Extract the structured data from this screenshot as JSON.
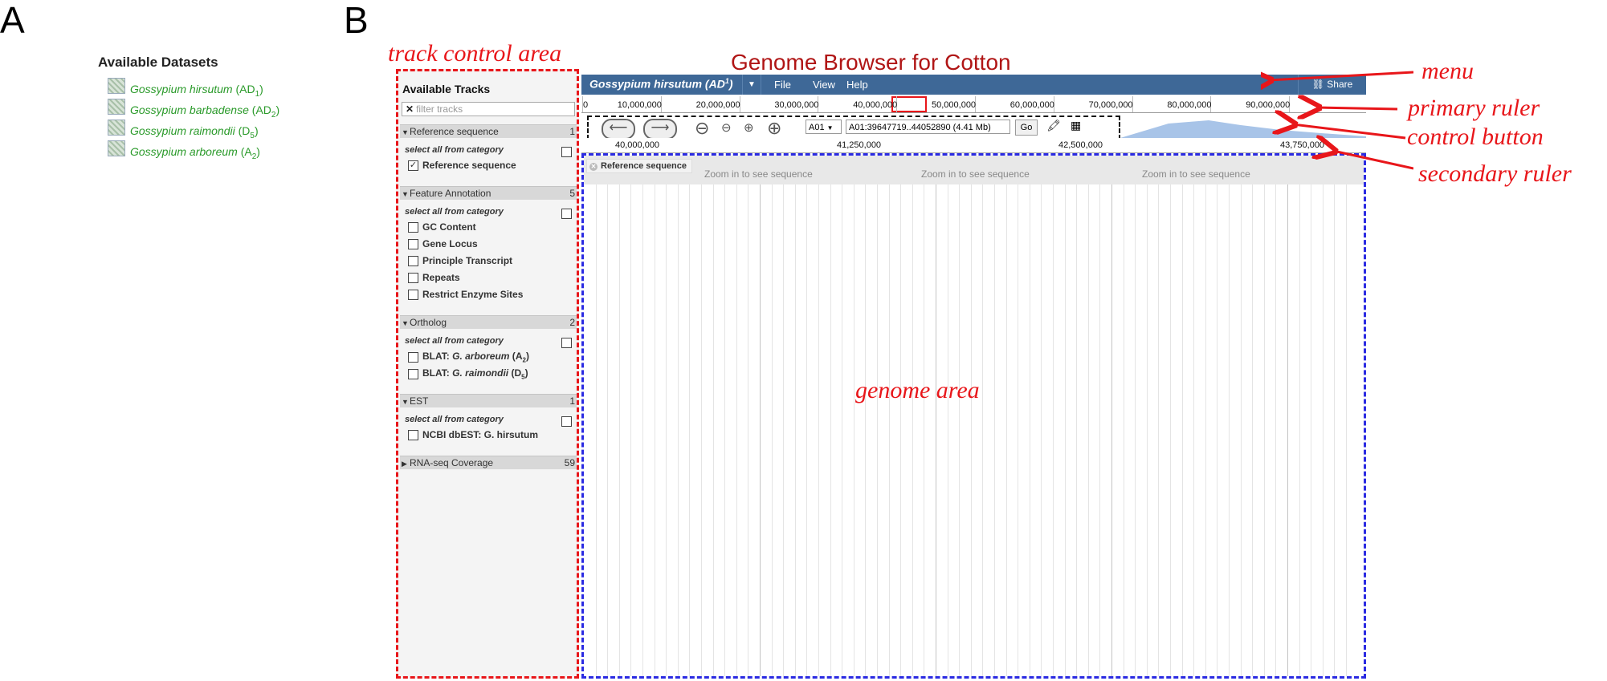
{
  "panel_a": {
    "letter": "A",
    "title": "Available Datasets",
    "datasets": [
      {
        "species": "Gossypium hirsutum",
        "genome": "AD",
        "sub": "1"
      },
      {
        "species": "Gossypium barbadense",
        "genome": "AD",
        "sub": "2"
      },
      {
        "species": "Gossypium raimondii",
        "genome": "D",
        "sub": "5"
      },
      {
        "species": "Gossypium arboreum",
        "genome": "A",
        "sub": "2"
      }
    ]
  },
  "panel_b": {
    "letter": "B",
    "title": "Genome Browser for Cotton",
    "annotations": {
      "track_control_area": "track control area",
      "menu": "menu",
      "primary_ruler": "primary ruler",
      "control_button": "control button",
      "secondary_ruler": "secondary ruler",
      "genome_area": "genome area"
    },
    "colors": {
      "annotation_red": "#e8161a",
      "genome_area_border": "#2b2be2",
      "menubar_bg": "#3e6897",
      "title_red": "#b01515"
    },
    "tracks_panel": {
      "title": "Available Tracks",
      "filter_placeholder": "filter tracks",
      "select_all_label": "select all from category",
      "categories": [
        {
          "name": "Reference sequence",
          "count": "1",
          "expanded": true,
          "tracks": [
            {
              "label": "Reference sequence",
              "checked": true
            }
          ]
        },
        {
          "name": "Feature Annotation",
          "count": "5",
          "expanded": true,
          "tracks": [
            {
              "label": "GC Content",
              "checked": false
            },
            {
              "label": "Gene Locus",
              "checked": false
            },
            {
              "label": "Principle Transcript",
              "checked": false
            },
            {
              "label": "Repeats",
              "checked": false
            },
            {
              "label": "Restrict Enzyme Sites",
              "checked": false
            }
          ]
        },
        {
          "name": "Ortholog",
          "count": "2",
          "expanded": true,
          "tracks": [
            {
              "label_prefix": "BLAT: ",
              "species": "G. arboreum",
              "genome": "A",
              "sub": "2",
              "checked": false
            },
            {
              "label_prefix": "BLAT: ",
              "species": "G. raimondii",
              "genome": "D",
              "sub": "5",
              "checked": false
            }
          ]
        },
        {
          "name": "EST",
          "count": "1",
          "expanded": true,
          "tracks": [
            {
              "label": "NCBI dbEST: G. hirsutum",
              "checked": false
            }
          ]
        },
        {
          "name": "RNA-seq Coverage",
          "count": "59",
          "expanded": false,
          "tracks": []
        }
      ]
    },
    "menubar": {
      "dataset_species": "Gossypium hirsutum",
      "dataset_genome": "AD",
      "dataset_sup": "1",
      "dropdown_icon": "chevron-down-icon",
      "items": [
        "File",
        "View",
        "Help"
      ],
      "share_label": "Share",
      "share_icon": "link-icon"
    },
    "primary_ruler": {
      "labels": [
        "0",
        "10,000,000",
        "20,000,000",
        "30,000,000",
        "40,000,000",
        "50,000,000",
        "60,000,000",
        "70,000,000",
        "80,000,000",
        "90,000,000"
      ]
    },
    "controls": {
      "pan_left_icon": "arrow-left-icon",
      "pan_right_icon": "arrow-right-icon",
      "zoom_out_big_icon": "zoom-out-big-icon",
      "zoom_out_icon": "zoom-out-icon",
      "zoom_in_icon": "zoom-in-icon",
      "zoom_in_big_icon": "zoom-in-big-icon",
      "ref_seq_value": "A01",
      "location_value": "A01:39647719..44052890 (4.41 Mb)",
      "go_label": "Go",
      "highlight_icon": "highlighter-icon",
      "overview_icon": "overview-icon"
    },
    "secondary_ruler": {
      "labels": [
        "40,000,000",
        "41,250,000",
        "42,500,000",
        "43,750,000"
      ]
    },
    "genome_area": {
      "track_label": "Reference sequence",
      "zoom_message": "Zoom in to see sequence",
      "close_icon": "close-icon"
    }
  }
}
